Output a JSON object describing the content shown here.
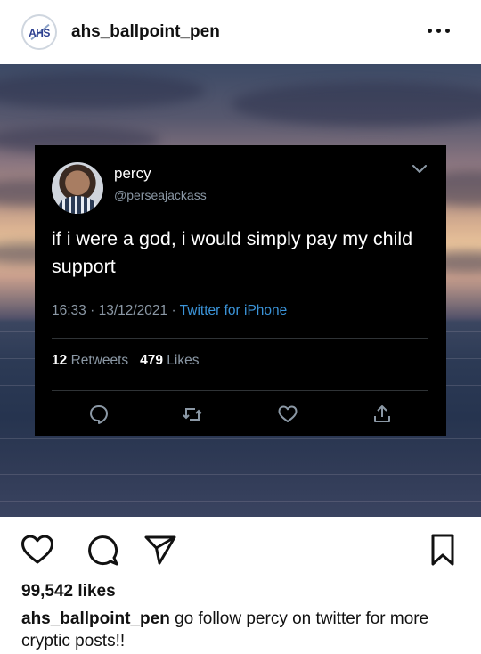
{
  "header": {
    "username": "ahs_ballpoint_pen",
    "avatar_logo_text": "AHS",
    "more_icon": "more-horizontal-icon"
  },
  "tweet": {
    "name": "percy",
    "handle": "@perseajackass",
    "text": "if i were a god, i would simply pay my child support",
    "time": "16:33",
    "date": "13/12/2021",
    "source": "Twitter for iPhone",
    "retweets_count": "12",
    "retweets_label": "Retweets",
    "likes_count": "479",
    "likes_label": "Likes",
    "actions": [
      "reply-icon",
      "retweet-icon",
      "like-icon",
      "share-icon"
    ]
  },
  "actions": {
    "icons": [
      "heart-icon",
      "comment-icon",
      "send-icon",
      "bookmark-icon"
    ]
  },
  "post": {
    "likes": "99,542 likes",
    "caption_user": "ahs_ballpoint_pen",
    "caption_text": "go follow percy on twitter for more cryptic posts!!"
  },
  "colors": {
    "link_blue": "#3b94d9",
    "muted_gray": "#8b98a5",
    "tweet_bg": "#000000"
  }
}
